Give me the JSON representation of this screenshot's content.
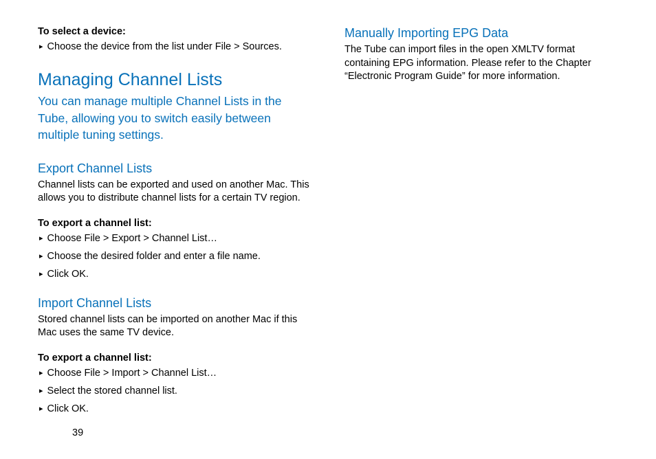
{
  "left": {
    "selectDevice": {
      "title": "To select a device:",
      "bullet1": "Choose the device from the list under File > Sources."
    },
    "managing": {
      "heading": "Managing Channel Lists",
      "intro": "You can manage multiple Channel Lists in the Tube, allowing you to switch easily between multiple tun­ing settings."
    },
    "export": {
      "heading": "Export Channel Lists",
      "body": "Channel lists can be exported and used on another Mac. This al­lows you to distribute channel lists for a certain TV region.",
      "stepsTitle": "To export a channel list:",
      "step1": "Choose File > Export > Channel List…",
      "step2": "Choose the desired folder and enter a file name.",
      "step3": "Click OK."
    },
    "import": {
      "heading": "Import Channel Lists",
      "body": "Stored channel lists can be imported on another Mac if this Mac uses the same TV device.",
      "stepsTitle": "To export a channel list:",
      "step1": "Choose File > Import > Channel List…",
      "step2": "Select the stored channel list.",
      "step3": "Click OK."
    }
  },
  "right": {
    "epg": {
      "heading": "Manually Importing EPG Data",
      "body": "The Tube can import files in the open XMLTV format containing EPG information. Please refer to the Chapter “Electronic Program Guide” for more information."
    }
  },
  "pageNumber": "39"
}
